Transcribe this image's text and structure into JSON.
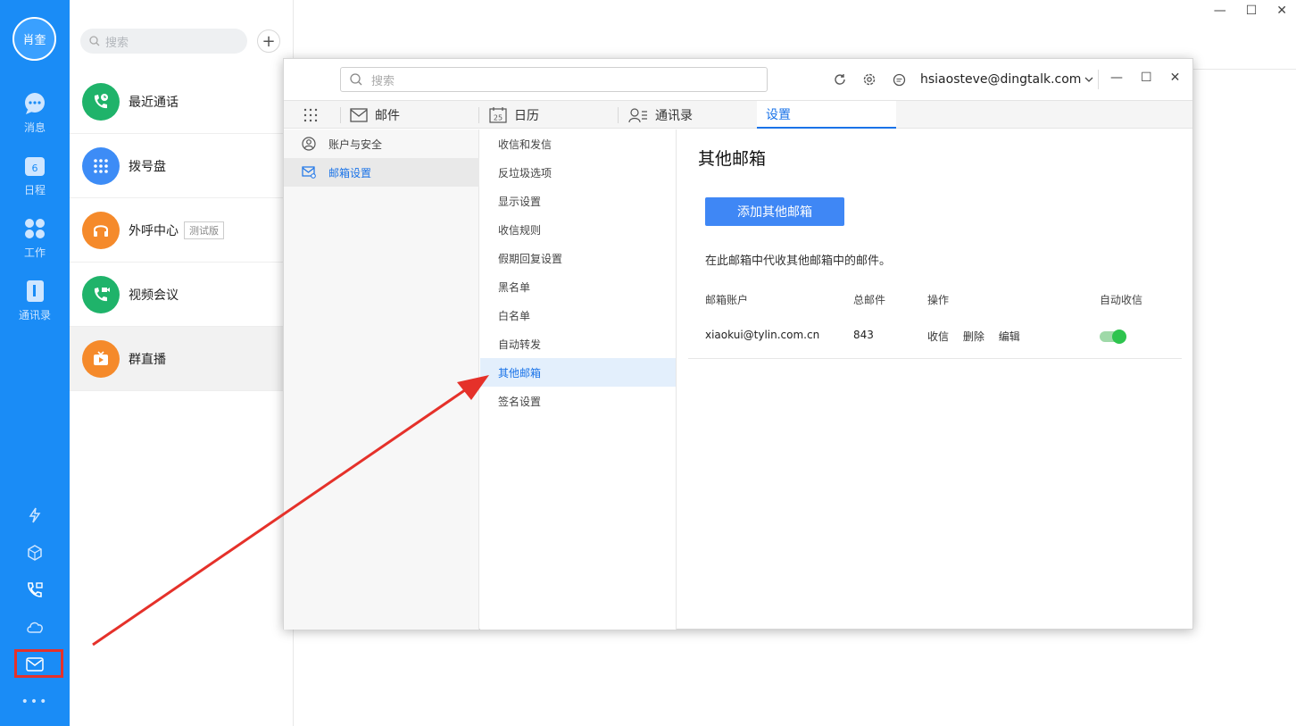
{
  "rail": {
    "avatar_text": "肖奎",
    "items": [
      {
        "label": "消息"
      },
      {
        "label": "日程",
        "badge": "6"
      },
      {
        "label": "工作"
      },
      {
        "label": "通讯录"
      }
    ],
    "more": "•••"
  },
  "list": {
    "search_placeholder": "搜索",
    "plus": "+",
    "items": [
      {
        "label": "最近通话",
        "color": "#1fb36a"
      },
      {
        "label": "拨号盘",
        "color": "#3d8cf6"
      },
      {
        "label": "外呼中心",
        "tag": "测试版",
        "color": "#f58a2b"
      },
      {
        "label": "视频会议",
        "color": "#1fb36a"
      },
      {
        "label": "群直播",
        "color": "#f58a2b"
      }
    ]
  },
  "main_window": {
    "buttons": {
      "minimize": "—",
      "maximize": "☐",
      "close": "✕"
    }
  },
  "mail": {
    "search_placeholder": "搜索",
    "account": "hsiaosteve@dingtalk.com",
    "win": {
      "minimize": "—",
      "maximize": "☐",
      "close": "✕"
    },
    "tabs": [
      {
        "label": "邮件"
      },
      {
        "label": "日历",
        "day": "25"
      },
      {
        "label": "通讯录"
      },
      {
        "label": "设置"
      }
    ],
    "col1": [
      {
        "label": "账户与安全"
      },
      {
        "label": "邮箱设置"
      }
    ],
    "col2": [
      "收信和发信",
      "反垃圾选项",
      "显示设置",
      "收信规则",
      "假期回复设置",
      "黑名单",
      "白名单",
      "自动转发",
      "其他邮箱",
      "签名设置"
    ],
    "content": {
      "title": "其他邮箱",
      "add_button": "添加其他邮箱",
      "description": "在此邮箱中代收其他邮箱中的邮件。",
      "headers": {
        "account": "邮箱账户",
        "total": "总邮件",
        "action": "操作",
        "auto": "自动收信"
      },
      "row": {
        "account": "xiaokui@tylin.com.cn",
        "total": "843",
        "ops": [
          "收信",
          "删除",
          "编辑"
        ],
        "auto_on": true
      }
    }
  },
  "colors": {
    "rail": "#1a8cf6",
    "accent": "#1a73e8",
    "button": "#3f87f5",
    "annotation": "#e5312a",
    "toggle": "#2ec44e"
  }
}
